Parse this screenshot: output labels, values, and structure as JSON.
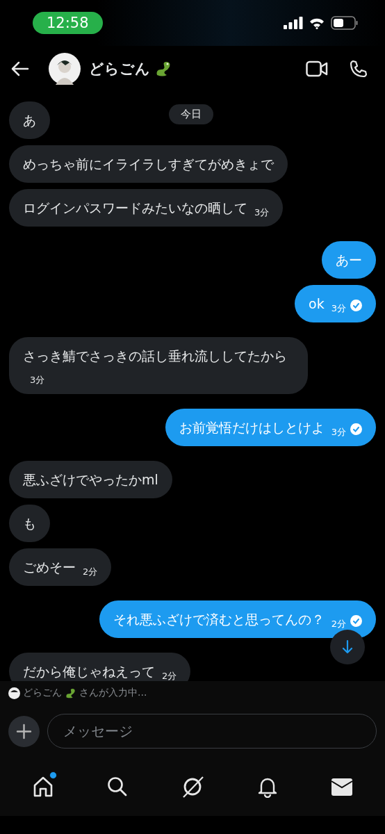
{
  "status_bar": {
    "time": "12:58"
  },
  "header": {
    "name": "どらごん"
  },
  "date_chip": "今日",
  "messages": [
    {
      "kind": "received",
      "text": "あ"
    },
    {
      "kind": "received",
      "text": "めっちゃ前にイライラしすぎてがめきょで"
    },
    {
      "kind": "received",
      "text": "ログインパスワードみたいなの晒して",
      "time": "3分"
    },
    {
      "kind": "sent",
      "text": "あー"
    },
    {
      "kind": "sent",
      "text": "ok",
      "time": "3分",
      "read": true
    },
    {
      "kind": "received",
      "text": "さっき鯖でさっきの話し垂れ流ししてたから",
      "time": "3分"
    },
    {
      "kind": "sent",
      "text": "お前覚悟だけはしとけよ",
      "time": "3分",
      "read": true
    },
    {
      "kind": "received",
      "text": "悪ふざけでやったかml"
    },
    {
      "kind": "received",
      "text": "も"
    },
    {
      "kind": "received",
      "text": "ごめそー",
      "time": "2分"
    },
    {
      "kind": "sent",
      "text": "それ悪ふざけで済むと思ってんの？",
      "time": "2分",
      "read": true
    },
    {
      "kind": "received",
      "text": "だから俺じゃねえって",
      "time": "2分"
    }
  ],
  "typing_indicator": {
    "name": "どらごん",
    "text": "さんが入力中..."
  },
  "composer": {
    "placeholder": "メッセージ"
  },
  "nav": [
    {
      "kind": "home",
      "badge": true
    },
    {
      "kind": "search",
      "badge": false
    },
    {
      "kind": "grok",
      "badge": false
    },
    {
      "kind": "bell",
      "badge": false
    },
    {
      "kind": "mail",
      "badge": false
    }
  ]
}
